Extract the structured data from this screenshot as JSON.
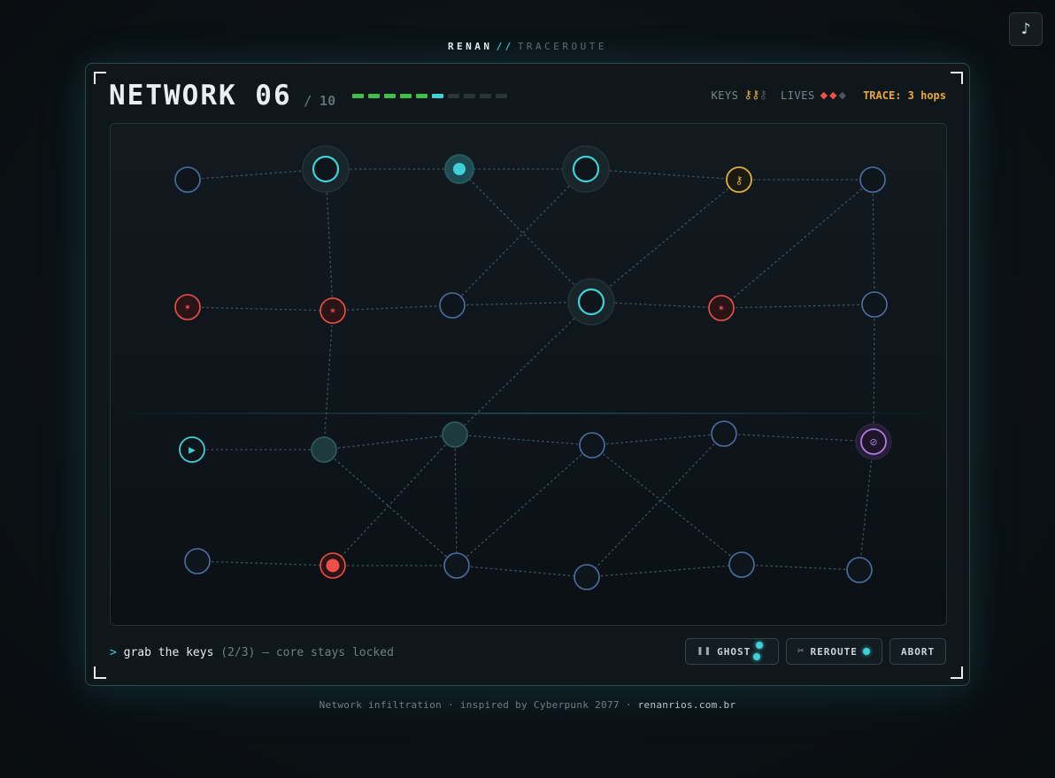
{
  "header": {
    "brand_name": "RENAN",
    "brand_sep": "//",
    "brand_app": "TRACEROUTE",
    "music_icon": "♪"
  },
  "level": {
    "title": "NETWORK 06",
    "total": "/ 10",
    "completed": 5,
    "current": 6,
    "count": 10
  },
  "hud": {
    "keys_label": "KEYS",
    "keys_collected": 2,
    "keys_total": 3,
    "lives_label": "LIVES",
    "lives_remaining": 2,
    "lives_total": 3,
    "trace": "TRACE: 3 hops"
  },
  "status": {
    "prompt": ">",
    "main": "grab the keys",
    "sub": "(2/3) — core stays locked"
  },
  "actions": {
    "ghost": "GHOST",
    "ghost_icon": "pause-icon",
    "ghost_charges": 2,
    "reroute": "REROUTE",
    "reroute_icon": "scissors-icon",
    "reroute_charges": 1,
    "abort": "ABORT"
  },
  "footer": {
    "text": "Network infiltration · inspired by Cyberpunk 2077 ·",
    "link": "renanrios.com.br"
  },
  "colors": {
    "accent": "#3fd0d8",
    "key": "#e0b040",
    "danger": "#f0504a",
    "core": "#b07ce0",
    "node": "#4a6fa8",
    "progress_done": "#3fbf4a"
  },
  "graph": {
    "nodes": [
      {
        "id": "n0",
        "type": "node"
      },
      {
        "id": "n1",
        "type": "visited"
      },
      {
        "id": "n2",
        "type": "player"
      },
      {
        "id": "n3",
        "type": "visited"
      },
      {
        "id": "n4",
        "type": "key",
        "glyph": "⚷"
      },
      {
        "id": "n5",
        "type": "node"
      },
      {
        "id": "n6",
        "type": "firewall",
        "glyph": "✶"
      },
      {
        "id": "n7",
        "type": "firewall",
        "glyph": "✶"
      },
      {
        "id": "n8",
        "type": "node"
      },
      {
        "id": "n9",
        "type": "visited"
      },
      {
        "id": "n10",
        "type": "firewall",
        "glyph": "✶"
      },
      {
        "id": "n11",
        "type": "node"
      },
      {
        "id": "n12",
        "type": "start",
        "glyph": "▶"
      },
      {
        "id": "n13",
        "type": "path"
      },
      {
        "id": "n14",
        "type": "path"
      },
      {
        "id": "n15",
        "type": "node"
      },
      {
        "id": "n16",
        "type": "node"
      },
      {
        "id": "n17",
        "type": "core",
        "glyph": "⊘"
      },
      {
        "id": "n18",
        "type": "node"
      },
      {
        "id": "n19",
        "type": "hunter"
      },
      {
        "id": "n20",
        "type": "node"
      },
      {
        "id": "n21",
        "type": "node"
      },
      {
        "id": "n22",
        "type": "node"
      },
      {
        "id": "n23",
        "type": "node"
      }
    ],
    "edges": [
      [
        "n0",
        "n1"
      ],
      [
        "n1",
        "n2"
      ],
      [
        "n2",
        "n3"
      ],
      [
        "n3",
        "n4"
      ],
      [
        "n4",
        "n5"
      ],
      [
        "n1",
        "n7"
      ],
      [
        "n2",
        "n9"
      ],
      [
        "n3",
        "n8"
      ],
      [
        "n4",
        "n9"
      ],
      [
        "n5",
        "n10"
      ],
      [
        "n5",
        "n11"
      ],
      [
        "n6",
        "n7"
      ],
      [
        "n7",
        "n8"
      ],
      [
        "n8",
        "n9"
      ],
      [
        "n9",
        "n10"
      ],
      [
        "n10",
        "n11"
      ],
      [
        "n7",
        "n13"
      ],
      [
        "n9",
        "n14"
      ],
      [
        "n11",
        "n17"
      ],
      [
        "n12",
        "n13"
      ],
      [
        "n13",
        "n14"
      ],
      [
        "n14",
        "n15"
      ],
      [
        "n15",
        "n16"
      ],
      [
        "n16",
        "n17"
      ],
      [
        "n13",
        "n20"
      ],
      [
        "n14",
        "n19"
      ],
      [
        "n14",
        "n20"
      ],
      [
        "n15",
        "n20"
      ],
      [
        "n15",
        "n22"
      ],
      [
        "n16",
        "n21"
      ],
      [
        "n17",
        "n23"
      ],
      [
        "n18",
        "n19"
      ],
      [
        "n19",
        "n20"
      ],
      [
        "n20",
        "n21"
      ],
      [
        "n21",
        "n22"
      ],
      [
        "n22",
        "n23"
      ]
    ]
  }
}
